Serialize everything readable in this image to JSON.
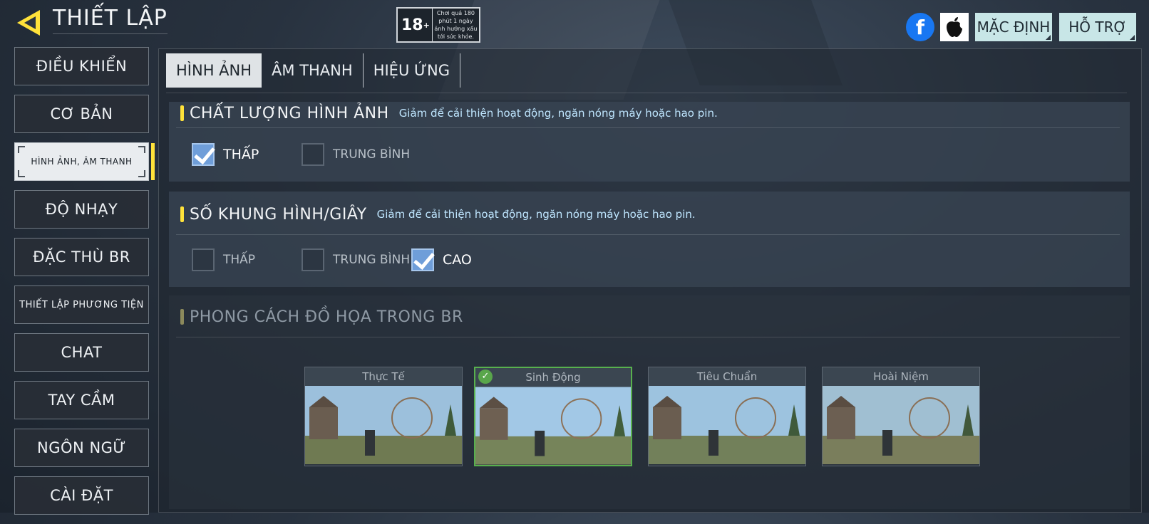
{
  "header": {
    "title": "THIẾT LẬP",
    "age_rating": "18",
    "age_rating_suffix": "+",
    "age_warning": "Chơi quá 180 phút 1 ngày ảnh hưởng xấu tới sức khỏe.",
    "facebook_glyph": "f",
    "default_button": "MẶC ĐỊNH",
    "support_button": "HỖ TRỢ"
  },
  "sidebar": {
    "items": [
      {
        "label": "ĐIỀU KHIỂN"
      },
      {
        "label": "CƠ BẢN"
      },
      {
        "label": "HÌNH ẢNH, ÂM THANH"
      },
      {
        "label": "ĐỘ NHẠY"
      },
      {
        "label": "ĐẶC THÙ BR"
      },
      {
        "label": "THIẾT LẬP PHƯƠNG TIỆN"
      },
      {
        "label": "CHAT"
      },
      {
        "label": "TAY CẦM"
      },
      {
        "label": "NGÔN NGỮ"
      },
      {
        "label": "CÀI ĐẶT"
      }
    ],
    "active_index": 2
  },
  "tabs": [
    {
      "label": "HÌNH ẢNH",
      "active": true
    },
    {
      "label": "ÂM THANH",
      "active": false
    },
    {
      "label": "HIỆU ỨNG",
      "active": false
    }
  ],
  "graphics_quality": {
    "title": "CHẤT LƯỢNG HÌNH ẢNH",
    "description": "Giảm để cải thiện hoạt động, ngăn nóng máy hoặc hao pin.",
    "options": [
      {
        "label": "THẤP",
        "checked": true
      },
      {
        "label": "TRUNG BÌNH",
        "checked": false
      }
    ]
  },
  "frame_rate": {
    "title": "SỐ KHUNG HÌNH/GIÂY",
    "description": "Giảm để cải thiện hoạt động, ngăn nóng máy hoặc hao pin.",
    "options": [
      {
        "label": "THẤP",
        "checked": false
      },
      {
        "label": "TRUNG BÌNH",
        "checked": false
      },
      {
        "label": "CAO",
        "checked": true
      }
    ]
  },
  "br_style": {
    "title": "PHONG CÁCH ĐỒ HỌA TRONG BR",
    "styles": [
      {
        "label": "Thực Tế",
        "selected": false
      },
      {
        "label": "Sinh Động",
        "selected": true
      },
      {
        "label": "Tiêu Chuẩn",
        "selected": false
      },
      {
        "label": "Hoài Niệm",
        "selected": false
      }
    ]
  },
  "colors": {
    "accent_yellow": "#ffe23a",
    "checkbox_on": "#6f9ed9",
    "selected_border": "#58b04e",
    "facebook": "#1877f2"
  }
}
